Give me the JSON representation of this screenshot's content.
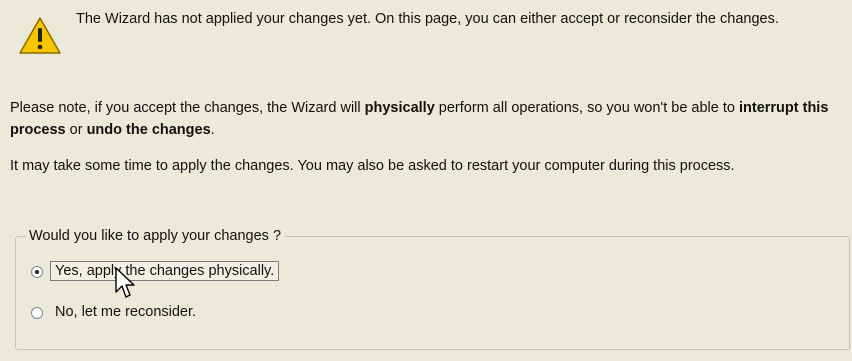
{
  "icon": "warning-triangle-icon",
  "warning_text": "The Wizard has not applied your changes yet. On this page, you can either accept or reconsider the changes.",
  "note": {
    "part1": "Please note, if you accept the changes, the Wizard will ",
    "bold1": "physically",
    "part2": " perform all operations, so you won't be able to ",
    "bold2": "interrupt this process",
    "part3": " or ",
    "bold3": "undo the changes",
    "part4": "."
  },
  "time_note": "It may take some time to apply the changes. You may also be asked to restart your computer during this process.",
  "group": {
    "legend": "Would you like to apply your changes ?",
    "options": [
      {
        "label": "Yes, apply the changes physically.",
        "selected": true
      },
      {
        "label": "No, let me reconsider.",
        "selected": false
      }
    ]
  },
  "colors": {
    "background": "#ece9d8",
    "warning_yellow": "#f5c400"
  },
  "cursor_icon": "mouse-pointer-icon"
}
